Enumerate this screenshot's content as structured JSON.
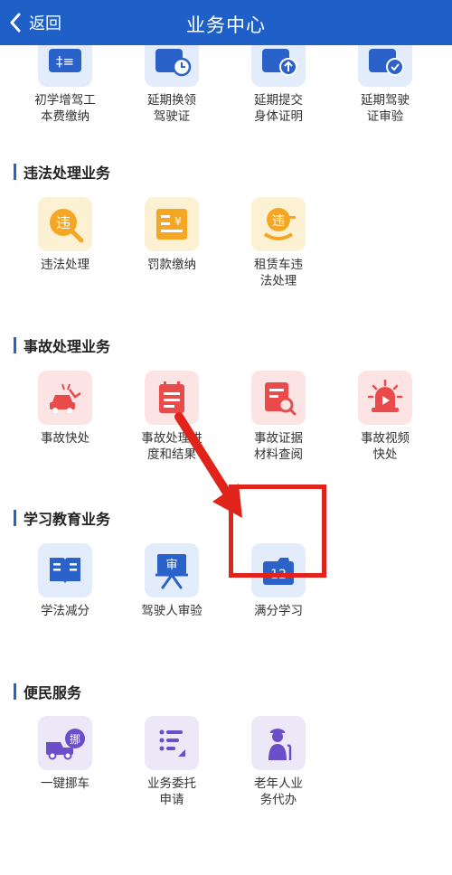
{
  "header": {
    "back_label": "返回",
    "title": "业务中心"
  },
  "top_row": [
    {
      "label": "初学增驾工\n本费缴纳",
      "icon": "fee-payment-icon"
    },
    {
      "label": "延期换领\n驾驶证",
      "icon": "license-renewal-clock-icon"
    },
    {
      "label": "延期提交\n身体证明",
      "icon": "health-upload-icon"
    },
    {
      "label": "延期驾驶\n证审验",
      "icon": "license-check-icon"
    }
  ],
  "sections": [
    {
      "title": "违法处理业务",
      "items": [
        {
          "label": "违法处理",
          "icon": "violation-search-icon",
          "glyph": "违"
        },
        {
          "label": "罚款缴纳",
          "icon": "fine-payment-icon",
          "glyph": "¥"
        },
        {
          "label": "租赁车违\n法处理",
          "icon": "rental-violation-icon",
          "glyph": "违"
        }
      ]
    },
    {
      "title": "事故处理业务",
      "items": [
        {
          "label": "事故快处",
          "icon": "car-accident-icon"
        },
        {
          "label": "事故处理进\n度和结果",
          "icon": "accident-progress-icon"
        },
        {
          "label": "事故证据\n材料查阅",
          "icon": "evidence-search-icon"
        },
        {
          "label": "事故视频\n快处",
          "icon": "video-alarm-icon"
        }
      ]
    },
    {
      "title": "学习教育业务",
      "items": [
        {
          "label": "学法减分",
          "icon": "book-icon"
        },
        {
          "label": "驾驶人审验",
          "icon": "review-board-icon",
          "glyph": "审"
        },
        {
          "label": "满分学习",
          "icon": "full-score-12-icon",
          "glyph": "12"
        }
      ]
    },
    {
      "title": "便民服务",
      "items": [
        {
          "label": "一键挪车",
          "icon": "move-car-truck-icon",
          "glyph": "挪"
        },
        {
          "label": "业务委托\n申请",
          "icon": "delegation-list-icon"
        },
        {
          "label": "老年人业\n务代办",
          "icon": "elderly-person-icon"
        }
      ]
    }
  ],
  "colors": {
    "header_bg": "#1f5fc8",
    "accent_blue": "#2a62c9",
    "accent_yellow": "#f5a623",
    "accent_red": "#e94b4b",
    "accent_purple": "#6a4fc8",
    "highlight_red": "#e0241b"
  }
}
